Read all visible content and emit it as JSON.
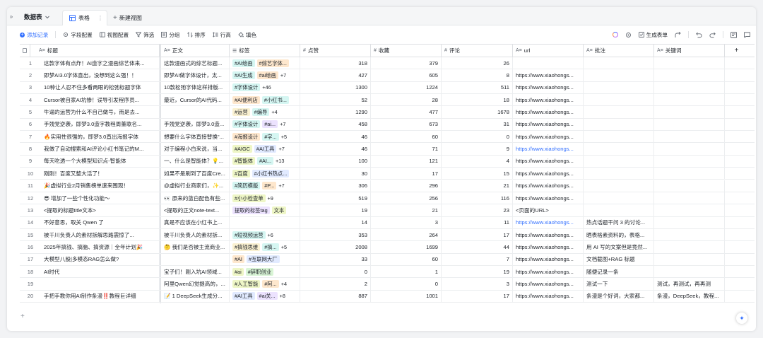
{
  "tabbar": {
    "collapse_icon": "»",
    "dataset_label": "数据表",
    "active_tab": "表格",
    "new_view": "新建视图"
  },
  "toolbar": {
    "add_record": "添加记录",
    "field_config": "字段配置",
    "view_config": "视图配置",
    "filter": "筛选",
    "group": "分组",
    "sort": "排序",
    "row_height": "行高",
    "fill": "填色",
    "generate_form": "生成表单"
  },
  "columns": [
    {
      "key": "title",
      "label": "标题",
      "icon": "text-icon"
    },
    {
      "key": "body",
      "label": "正文",
      "icon": "text-icon"
    },
    {
      "key": "tags",
      "label": "标签",
      "icon": "list-icon"
    },
    {
      "key": "likes",
      "label": "点赞",
      "icon": "number-icon"
    },
    {
      "key": "favs",
      "label": "收藏",
      "icon": "number-icon"
    },
    {
      "key": "comments",
      "label": "评论",
      "icon": "number-icon"
    },
    {
      "key": "url",
      "label": "url",
      "icon": "text-icon"
    },
    {
      "key": "note",
      "label": "批注",
      "icon": "text-icon"
    },
    {
      "key": "keywords",
      "label": "关键词",
      "icon": "text-icon"
    }
  ],
  "tag_colors": {
    "blue": {
      "bg": "#e1eaff",
      "fg": "#1f2329"
    },
    "green": {
      "bg": "#d9f5d6",
      "fg": "#1f2329"
    },
    "orange": {
      "bg": "#fee7cd",
      "fg": "#1f2329"
    },
    "purple": {
      "bg": "#ece2fe",
      "fg": "#1f2329"
    },
    "teal": {
      "bg": "#d5f6f2",
      "fg": "#1f2329"
    },
    "yellow": {
      "bg": "#faf1d1",
      "fg": "#1f2329"
    },
    "lime": {
      "bg": "#eef6c6",
      "fg": "#1f2329"
    }
  },
  "rows": [
    {
      "n": "1",
      "title": "这款字体有点炸！AI造字之漫画综艺体来...",
      "body": "这款漫画式的综艺标题...",
      "tags": [
        {
          "t": "#AI绘画",
          "c": "teal"
        },
        {
          "t": "#综艺字体...",
          "c": "orange"
        }
      ],
      "more": "",
      "likes": "318",
      "favs": "379",
      "comments": "26",
      "url": "",
      "url_link": false,
      "note": "",
      "keywords": ""
    },
    {
      "n": "2",
      "title": "即梦AI3.0字体直出，没想到这么强！！",
      "body": "即梦AI做字体设计，太...",
      "tags": [
        {
          "t": "#AI生成",
          "c": "teal"
        },
        {
          "t": "#ai绘画",
          "c": "orange"
        }
      ],
      "more": "+7",
      "likes": "427",
      "favs": "605",
      "comments": "8",
      "url": "https://www.xiaohongs...",
      "url_link": false,
      "note": "",
      "keywords": ""
    },
    {
      "n": "3",
      "title": "10种让人忍不住多看两眼的松弛标题字体",
      "body": "10款松弛字体这样排版...",
      "tags": [
        {
          "t": "#字体设计",
          "c": "teal"
        }
      ],
      "more": "+46",
      "likes": "1300",
      "favs": "1224",
      "comments": "511",
      "url": "https://www.xiaohongs...",
      "url_link": false,
      "note": "",
      "keywords": ""
    },
    {
      "n": "4",
      "title": "Cursor被自家AI坑惨！误导引发程序员...",
      "body": "最近，Cursor的AI代码...",
      "tags": [
        {
          "t": "#AI便利店",
          "c": "orange"
        },
        {
          "t": "#小红书...",
          "c": "teal"
        }
      ],
      "more": "",
      "likes": "52",
      "favs": "28",
      "comments": "18",
      "url": "https://www.xiaohongs...",
      "url_link": false,
      "note": "",
      "keywords": ""
    },
    {
      "n": "5",
      "title": "牛逼的运营为什么不自己做号，而是去...",
      "body": "",
      "tags": [
        {
          "t": "#运营",
          "c": "yellow"
        },
        {
          "t": "#编导",
          "c": "teal"
        }
      ],
      "more": "+4",
      "likes": "1290",
      "favs": "477",
      "comments": "1678",
      "url": "https://www.xiaohongs...",
      "url_link": false,
      "note": "",
      "keywords": ""
    },
    {
      "n": "6",
      "title": "手残党逆袭，即梦3.0造字教程周董歌名...",
      "body": "手残党逆袭，即梦3.0造...",
      "tags": [
        {
          "t": "#字体设计",
          "c": "teal"
        },
        {
          "t": "#ai...",
          "c": "purple"
        }
      ],
      "more": "+7",
      "likes": "458",
      "favs": "673",
      "comments": "31",
      "url": "https://www.xiaohongs...",
      "url_link": false,
      "note": "",
      "keywords": ""
    },
    {
      "n": "7",
      "title": "🔥实用性很强的，即梦3.0直出海报字体",
      "body": "想要什么字体直接替换\"...",
      "tags": [
        {
          "t": "#海报设计",
          "c": "orange"
        },
        {
          "t": "#字...",
          "c": "teal"
        }
      ],
      "more": "+5",
      "likes": "46",
      "favs": "60",
      "comments": "0",
      "url": "https://www.xiaohongs...",
      "url_link": false,
      "note": "",
      "keywords": ""
    },
    {
      "n": "8",
      "title": "我做了自动搜索和AI评论小红书笔记的M...",
      "body": "对于编程小白来说，当...",
      "tags": [
        {
          "t": "#AIGC",
          "c": "lime"
        },
        {
          "t": "#AI工具",
          "c": "blue"
        }
      ],
      "more": "+7",
      "likes": "46",
      "favs": "71",
      "comments": "9",
      "url": "https://www.xiaohongs...",
      "url_link": true,
      "note": "",
      "keywords": ""
    },
    {
      "n": "9",
      "title": "每天吃透一个大模型知识点-智能体",
      "body": "一、什么是智能体？💡...",
      "tags": [
        {
          "t": "#智能体",
          "c": "lime"
        },
        {
          "t": "#AI...",
          "c": "teal"
        }
      ],
      "more": "+13",
      "likes": "100",
      "favs": "121",
      "comments": "4",
      "url": "https://www.xiaohongs...",
      "url_link": false,
      "note": "",
      "keywords": ""
    },
    {
      "n": "10",
      "title": "刚刚！百度又整大活了！",
      "body": "如果不是刷到了百度Cre...",
      "tags": [
        {
          "t": "#百度",
          "c": "lime"
        },
        {
          "t": "#小红书热点...",
          "c": "blue"
        }
      ],
      "more": "",
      "likes": "30",
      "favs": "17",
      "comments": "15",
      "url": "https://www.xiaohongs...",
      "url_link": false,
      "note": "",
      "keywords": ""
    },
    {
      "n": "11",
      "title": "🎉虚拟行业2月销售榜单速来围观！",
      "body": "@虚拟行业商家们，✨...",
      "tags": [
        {
          "t": "#简历模版",
          "c": "teal"
        },
        {
          "t": "#P...",
          "c": "orange"
        }
      ],
      "more": "+7",
      "likes": "306",
      "favs": "296",
      "comments": "21",
      "url": "https://www.xiaohongs...",
      "url_link": false,
      "note": "",
      "keywords": ""
    },
    {
      "n": "12",
      "title": "😎 增加了一些个性化功能～",
      "body": "👀 原来的蓝白配色有些...",
      "tags": [
        {
          "t": "#小小检查单",
          "c": "lime"
        }
      ],
      "more": "+9",
      "likes": "519",
      "favs": "256",
      "comments": "116",
      "url": "https://www.xiaohongs...",
      "url_link": false,
      "note": "",
      "keywords": ""
    },
    {
      "n": "13",
      "title": "<提取的标题title文本>",
      "body": "<提取的正文note-text...",
      "tags": [
        {
          "t": "提取的标签tag",
          "c": "purple"
        },
        {
          "t": "文本",
          "c": "lime"
        }
      ],
      "more": "",
      "likes": "19",
      "favs": "21",
      "comments": "23",
      "url": "<页面的URL>",
      "url_link": false,
      "note": "",
      "keywords": ""
    },
    {
      "n": "14",
      "title": "不好意思，取关 Qwen 了",
      "body": "真是不应该在小红书上...",
      "tags": [],
      "more": "",
      "likes": "14",
      "favs": "3",
      "comments": "11",
      "url": "https://www.xiaohongs...",
      "url_link": true,
      "note": "热点话题干问 3 的讨论...",
      "keywords": ""
    },
    {
      "n": "15",
      "title": "被千川负责人的素材拆解思路震惊了...",
      "body": "被千川负责人的素材拆...",
      "tags": [
        {
          "t": "#短视频运营",
          "c": "teal"
        }
      ],
      "more": "+6",
      "likes": "353",
      "favs": "264",
      "comments": "17",
      "url": "https://www.xiaohongs...",
      "url_link": false,
      "note": "晒表格素资料的，表格...",
      "keywords": ""
    },
    {
      "n": "16",
      "title": "2025年搞钱、搞脑、搞资源｜全年计划🎉",
      "body": "🤔 我们是否被主流商业...",
      "tags": [
        {
          "t": "#搞钱思维",
          "c": "yellow"
        },
        {
          "t": "#搞...",
          "c": "teal"
        }
      ],
      "more": "+5",
      "likes": "2008",
      "favs": "1699",
      "comments": "44",
      "url": "https://www.xiaohongs...",
      "url_link": false,
      "note": "用 AI 写的文案但是竟然...",
      "keywords": ""
    },
    {
      "n": "17",
      "title": "大模型八股|多模态RAG怎么做?",
      "body": "",
      "tags": [
        {
          "t": "#AI",
          "c": "orange"
        },
        {
          "t": "#互联网大厂",
          "c": "blue"
        }
      ],
      "more": "",
      "likes": "33",
      "favs": "60",
      "comments": "7",
      "url": "https://www.xiaohongs...",
      "url_link": false,
      "note": "文档截图+RAG 标题",
      "keywords": ""
    },
    {
      "n": "18",
      "title": "AI时代",
      "body": "宝子们！刚入坑AI领域...",
      "tags": [
        {
          "t": "#ai",
          "c": "lime"
        },
        {
          "t": "#辞职创业",
          "c": "green"
        }
      ],
      "more": "",
      "likes": "0",
      "favs": "1",
      "comments": "19",
      "url": "https://www.xiaohongs...",
      "url_link": false,
      "note": "随便记录一条",
      "keywords": ""
    },
    {
      "n": "19",
      "title": "",
      "body": "阿里Qwen幻觉提高的，...",
      "tags": [
        {
          "t": "#人工智能",
          "c": "lime"
        },
        {
          "t": "#阿...",
          "c": "orange"
        }
      ],
      "more": "+4",
      "likes": "2",
      "favs": "0",
      "comments": "3",
      "url": "https://www.xiaohongs...",
      "url_link": false,
      "note": "测试一下",
      "keywords": "测试，再测试，再再测"
    },
    {
      "n": "20",
      "title": "手把手教你用AI制作条漫‼️教程巨详细",
      "body": "📝 1 DeepSeek生成分...",
      "tags": [
        {
          "t": "#AI工具",
          "c": "blue"
        },
        {
          "t": "#ai关...",
          "c": "purple"
        }
      ],
      "more": "+8",
      "likes": "887",
      "favs": "1001",
      "comments": "17",
      "url": "https://www.xiaohongs...",
      "url_link": false,
      "note": "条漫是个好词，大家都...",
      "keywords": "条漫，DeepSeek，教程..."
    }
  ]
}
